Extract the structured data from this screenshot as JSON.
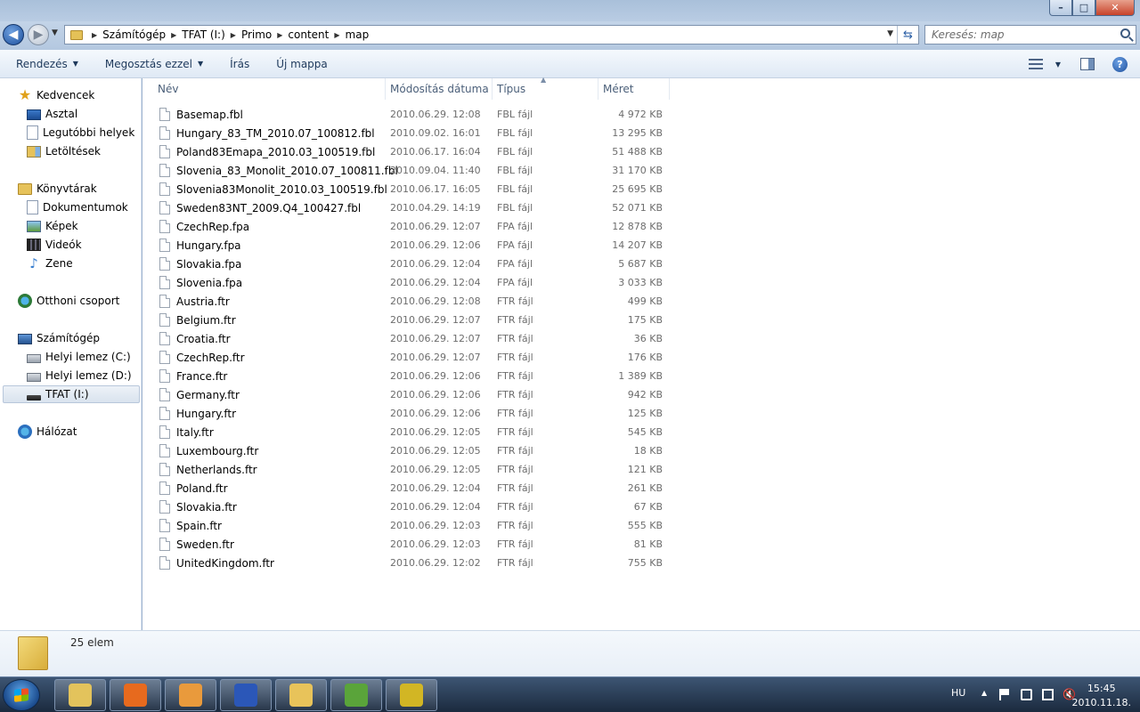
{
  "window": {
    "controls": {
      "minimize": "–",
      "maximize": "□",
      "close": "✕"
    }
  },
  "nav": {
    "back_glyph": "◀",
    "forward_glyph": "▶",
    "breadcrumbs": [
      "Számítógép",
      "TFAT (I:)",
      "Primo",
      "content",
      "map"
    ],
    "search_placeholder": "Keresés: map"
  },
  "toolbar": {
    "organize": "Rendezés",
    "share": "Megosztás ezzel",
    "burn": "Írás",
    "new_folder": "Új mappa",
    "help": "?"
  },
  "navpane": {
    "favorites": {
      "label": "Kedvencek",
      "items": [
        "Asztal",
        "Legutóbbi helyek",
        "Letöltések"
      ]
    },
    "libraries": {
      "label": "Könyvtárak",
      "items": [
        "Dokumentumok",
        "Képek",
        "Videók",
        "Zene"
      ]
    },
    "homegroup": "Otthoni csoport",
    "computer": {
      "label": "Számítógép",
      "items": [
        "Helyi lemez (C:)",
        "Helyi lemez (D:)",
        "TFAT (I:)"
      ]
    },
    "network": "Hálózat",
    "selected": "TFAT (I:)"
  },
  "columns": {
    "name": "Név",
    "date": "Módosítás dátuma",
    "type": "Típus",
    "size": "Méret"
  },
  "files": [
    {
      "name": "Basemap.fbl",
      "date": "2010.06.29. 12:08",
      "type": "FBL fájl",
      "size": "4 972 KB"
    },
    {
      "name": "Hungary_83_TM_2010.07_100812.fbl",
      "date": "2010.09.02. 16:01",
      "type": "FBL fájl",
      "size": "13 295 KB"
    },
    {
      "name": "Poland83Emapa_2010.03_100519.fbl",
      "date": "2010.06.17. 16:04",
      "type": "FBL fájl",
      "size": "51 488 KB"
    },
    {
      "name": "Slovenia_83_Monolit_2010.07_100811.fbl",
      "date": "2010.09.04. 11:40",
      "type": "FBL fájl",
      "size": "31 170 KB"
    },
    {
      "name": "Slovenia83Monolit_2010.03_100519.fbl",
      "date": "2010.06.17. 16:05",
      "type": "FBL fájl",
      "size": "25 695 KB"
    },
    {
      "name": "Sweden83NT_2009.Q4_100427.fbl",
      "date": "2010.04.29. 14:19",
      "type": "FBL fájl",
      "size": "52 071 KB"
    },
    {
      "name": "CzechRep.fpa",
      "date": "2010.06.29. 12:07",
      "type": "FPA fájl",
      "size": "12 878 KB"
    },
    {
      "name": "Hungary.fpa",
      "date": "2010.06.29. 12:06",
      "type": "FPA fájl",
      "size": "14 207 KB"
    },
    {
      "name": "Slovakia.fpa",
      "date": "2010.06.29. 12:04",
      "type": "FPA fájl",
      "size": "5 687 KB"
    },
    {
      "name": "Slovenia.fpa",
      "date": "2010.06.29. 12:04",
      "type": "FPA fájl",
      "size": "3 033 KB"
    },
    {
      "name": "Austria.ftr",
      "date": "2010.06.29. 12:08",
      "type": "FTR fájl",
      "size": "499 KB"
    },
    {
      "name": "Belgium.ftr",
      "date": "2010.06.29. 12:07",
      "type": "FTR fájl",
      "size": "175 KB"
    },
    {
      "name": "Croatia.ftr",
      "date": "2010.06.29. 12:07",
      "type": "FTR fájl",
      "size": "36 KB"
    },
    {
      "name": "CzechRep.ftr",
      "date": "2010.06.29. 12:07",
      "type": "FTR fájl",
      "size": "176 KB"
    },
    {
      "name": "France.ftr",
      "date": "2010.06.29. 12:06",
      "type": "FTR fájl",
      "size": "1 389 KB"
    },
    {
      "name": "Germany.ftr",
      "date": "2010.06.29. 12:06",
      "type": "FTR fájl",
      "size": "942 KB"
    },
    {
      "name": "Hungary.ftr",
      "date": "2010.06.29. 12:06",
      "type": "FTR fájl",
      "size": "125 KB"
    },
    {
      "name": "Italy.ftr",
      "date": "2010.06.29. 12:05",
      "type": "FTR fájl",
      "size": "545 KB"
    },
    {
      "name": "Luxembourg.ftr",
      "date": "2010.06.29. 12:05",
      "type": "FTR fájl",
      "size": "18 KB"
    },
    {
      "name": "Netherlands.ftr",
      "date": "2010.06.29. 12:05",
      "type": "FTR fájl",
      "size": "121 KB"
    },
    {
      "name": "Poland.ftr",
      "date": "2010.06.29. 12:04",
      "type": "FTR fájl",
      "size": "261 KB"
    },
    {
      "name": "Slovakia.ftr",
      "date": "2010.06.29. 12:04",
      "type": "FTR fájl",
      "size": "67 KB"
    },
    {
      "name": "Spain.ftr",
      "date": "2010.06.29. 12:03",
      "type": "FTR fájl",
      "size": "555 KB"
    },
    {
      "name": "Sweden.ftr",
      "date": "2010.06.29. 12:03",
      "type": "FTR fájl",
      "size": "81 KB"
    },
    {
      "name": "UnitedKingdom.ftr",
      "date": "2010.06.29. 12:02",
      "type": "FTR fájl",
      "size": "755 KB"
    }
  ],
  "details": {
    "count": "25 elem"
  },
  "taskbar": {
    "apps": [
      {
        "name": "windows-explorer-icon",
        "color": "#e3c35c"
      },
      {
        "name": "firefox-icon",
        "color": "#e76a1e"
      },
      {
        "name": "media-player-icon",
        "color": "#e99a3c"
      },
      {
        "name": "save-floppy-icon",
        "color": "#2b57b8"
      },
      {
        "name": "mail-app-icon",
        "color": "#e8c35a"
      },
      {
        "name": "messenger-icon",
        "color": "#5aa43a"
      },
      {
        "name": "map-app-icon",
        "color": "#d2b624"
      }
    ],
    "lang": "HU",
    "time": "15:45",
    "date": "2010.11.18."
  }
}
